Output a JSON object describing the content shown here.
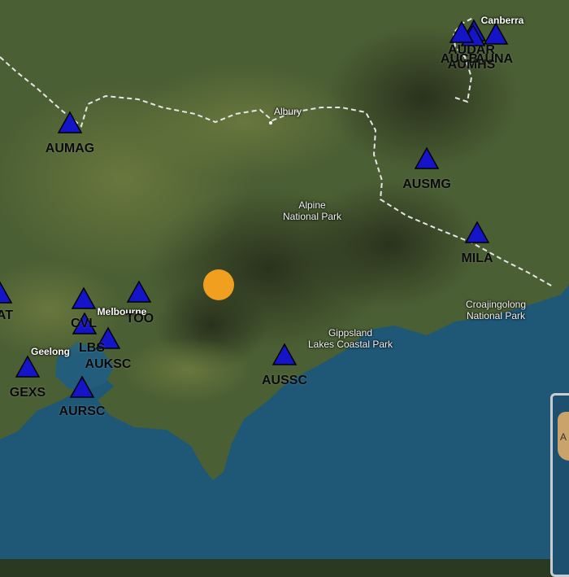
{
  "map": {
    "colors": {
      "sea": "#1f5877",
      "land": "#4b5f34",
      "border": "#e6e6e6",
      "station": "#1414c8",
      "event": "#f0a01e"
    },
    "places": [
      {
        "id": "canberra",
        "label": "Canberra"
      },
      {
        "id": "albury",
        "label": "Albury"
      },
      {
        "id": "melbourne",
        "label": "Melbourne"
      },
      {
        "id": "geelong",
        "label": "Geelong"
      }
    ],
    "parks": [
      {
        "id": "alpine",
        "line1": "Alpine",
        "line2": "National Park"
      },
      {
        "id": "croajingolong",
        "line1": "Croajingolong",
        "line2": "National Park"
      },
      {
        "id": "gippsland",
        "line1": "Gippsland",
        "line2": "Lakes Coastal Park"
      }
    ],
    "stations": [
      {
        "id": "aumag",
        "label": "AUMAG"
      },
      {
        "id": "ausmg",
        "label": "AUSMG"
      },
      {
        "id": "mila",
        "label": "MILA"
      },
      {
        "id": "aussc",
        "label": "AUSSC"
      },
      {
        "id": "gexs",
        "label": "GEXS"
      },
      {
        "id": "aursc",
        "label": "AURSC"
      },
      {
        "id": "auksc",
        "label": "AUKSC"
      },
      {
        "id": "lbs",
        "label": "LBS"
      },
      {
        "id": "cvl",
        "label": "CVL"
      },
      {
        "id": "too",
        "label": "TOO"
      },
      {
        "id": "at",
        "label": "AT"
      },
      {
        "id": "audar",
        "label": "AUDAR"
      },
      {
        "id": "aumhs",
        "label": "AUMHS"
      },
      {
        "id": "aucb",
        "label": "AUCB"
      },
      {
        "id": "auna",
        "label": "AUNA"
      }
    ],
    "event": {
      "id": "epicenter",
      "type": "earthquake"
    },
    "inset": {
      "label": "A"
    }
  }
}
